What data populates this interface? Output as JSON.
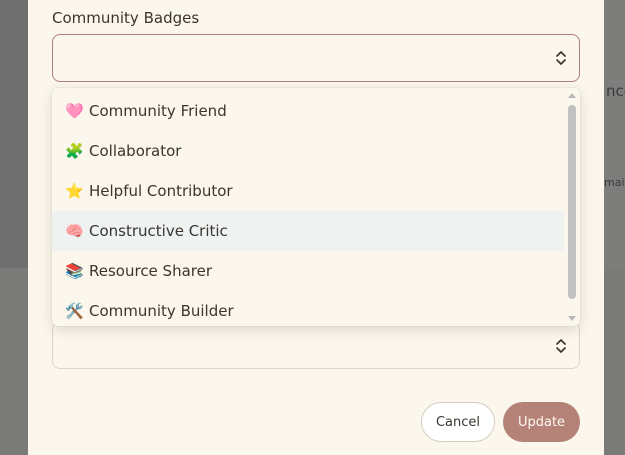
{
  "background": {
    "fragment_1": "nce",
    "fragment_2": "mail"
  },
  "form": {
    "badges_label": "Community Badges",
    "badges_value": "",
    "second_select_value": ""
  },
  "dropdown": {
    "options": [
      {
        "emoji": "🩷",
        "label": "Community Friend"
      },
      {
        "emoji": "🧩",
        "label": "Collaborator"
      },
      {
        "emoji": "⭐",
        "label": "Helpful Contributor"
      },
      {
        "emoji": "🧠",
        "label": "Constructive Critic",
        "highlighted": true
      },
      {
        "emoji": "📚",
        "label": "Resource Sharer"
      },
      {
        "emoji": "🛠️",
        "label": "Community Builder"
      }
    ]
  },
  "actions": {
    "cancel_label": "Cancel",
    "update_label": "Update"
  },
  "colors": {
    "accent": "#b48276",
    "modal_bg": "#fbf7ec",
    "highlight": "#eef3f1"
  }
}
